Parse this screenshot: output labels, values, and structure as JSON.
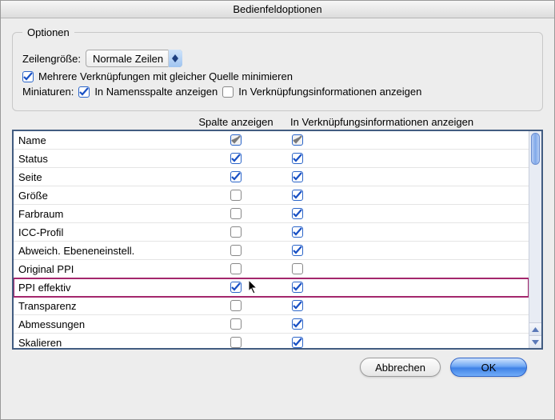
{
  "window": {
    "title": "Bedienfeldoptionen"
  },
  "options": {
    "legend": "Optionen",
    "row_size_label": "Zeilengröße:",
    "row_size_value": "Normale Zeilen",
    "minimize_label": "Mehrere Verknüpfungen mit gleicher Quelle minimieren",
    "minimize_checked": true,
    "thumbs_label": "Miniaturen:",
    "thumbs_name_label": "In Namensspalte anzeigen",
    "thumbs_name_checked": true,
    "thumbs_link_label": "In Verknüpfungsinformationen anzeigen",
    "thumbs_link_checked": false
  },
  "table": {
    "col1_header": "Spalte anzeigen",
    "col2_header": "In Verknüpfungsinformationen anzeigen",
    "rows": [
      {
        "name": "Name",
        "c1": true,
        "c1_disabled": true,
        "c2": true,
        "c2_disabled": true
      },
      {
        "name": "Status",
        "c1": true,
        "c2": true
      },
      {
        "name": "Seite",
        "c1": true,
        "c2": true
      },
      {
        "name": "Größe",
        "c1": false,
        "c2": true
      },
      {
        "name": "Farbraum",
        "c1": false,
        "c2": true
      },
      {
        "name": "ICC-Profil",
        "c1": false,
        "c2": true
      },
      {
        "name": "Abweich. Ebeneneinstell.",
        "c1": false,
        "c2": true
      },
      {
        "name": "Original PPI",
        "c1": false,
        "c2": false
      },
      {
        "name": "PPI effektiv",
        "c1": true,
        "c2": true,
        "highlight": true,
        "cursor": true
      },
      {
        "name": "Transparenz",
        "c1": false,
        "c2": true
      },
      {
        "name": "Abmessungen",
        "c1": false,
        "c2": true
      },
      {
        "name": "Skalieren",
        "c1": false,
        "c2": true
      }
    ]
  },
  "buttons": {
    "cancel": "Abbrechen",
    "ok": "OK"
  }
}
